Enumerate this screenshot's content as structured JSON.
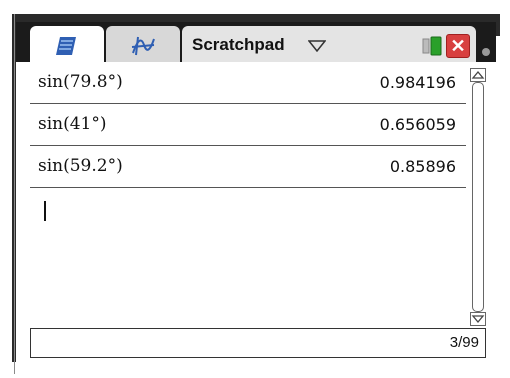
{
  "tabs": {
    "calculator_tab": {
      "icon": "calculator-icon"
    },
    "graphs_tab": {
      "icon": "graph-icon"
    },
    "title_tab": {
      "label": "Scratchpad",
      "dropdown_icon": "chevron-down-icon"
    }
  },
  "window_controls": {
    "battery_icon": "battery-icon",
    "close_label": "✕"
  },
  "history": [
    {
      "expression": "sin(79.8°)",
      "result": "0.984196"
    },
    {
      "expression": "sin(41°)",
      "result": "0.656059"
    },
    {
      "expression": "sin(59.2°)",
      "result": "0.85896"
    }
  ],
  "input": {
    "value": ""
  },
  "status": {
    "page_counter": "3/99"
  },
  "colors": {
    "bezel": "#1b1b1b",
    "close": "#d84040",
    "battery_green": "#2aa02a"
  }
}
